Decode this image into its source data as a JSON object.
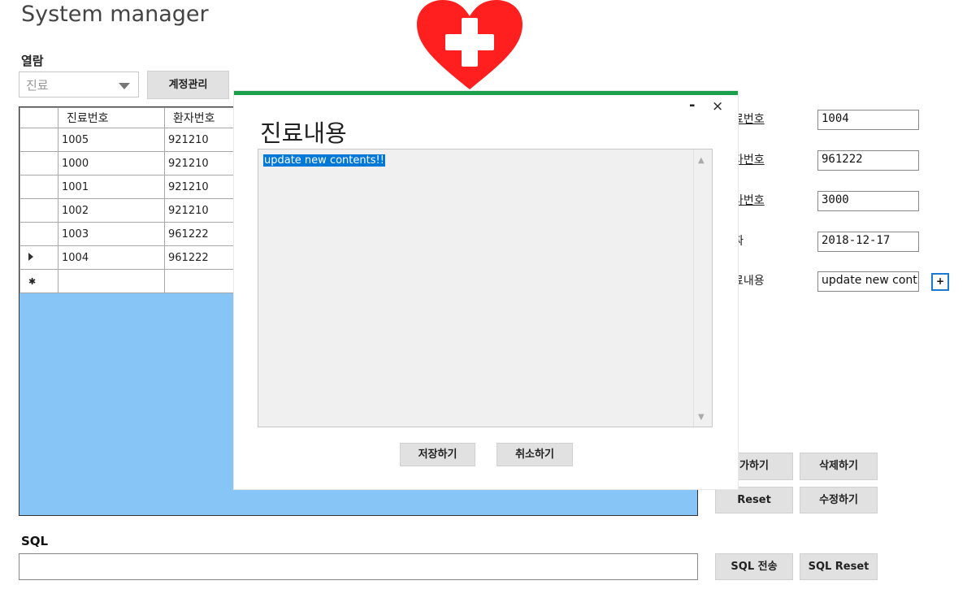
{
  "app": {
    "title": "System manager"
  },
  "view": {
    "label": "열람",
    "combo_value": "진료",
    "account_button": "계정관리"
  },
  "grid": {
    "headers": [
      "진료번호",
      "환자번호"
    ],
    "rows": [
      [
        "1005",
        "921210"
      ],
      [
        "1000",
        "921210"
      ],
      [
        "1001",
        "921210"
      ],
      [
        "1002",
        "921210"
      ],
      [
        "1003",
        "961222"
      ],
      [
        "1004",
        "961222"
      ]
    ],
    "current_row_index": 5
  },
  "form": {
    "labels": [
      "료번호",
      "자번호",
      "사번호",
      "짜",
      "료내용"
    ],
    "values": [
      "1004",
      "961222",
      "3000",
      "2018-12-17",
      "update new cont"
    ]
  },
  "buttons": {
    "add": "가하기",
    "delete": "삭제하기",
    "reset": "Reset",
    "update": "수정하기",
    "sql_send": "SQL 전송",
    "sql_reset": "SQL Reset",
    "plus": "+"
  },
  "sql": {
    "label": "SQL",
    "value": ""
  },
  "dialog": {
    "title": "진료내용",
    "minimize": "-",
    "close": "×",
    "content": "update new contents!!",
    "save_button": "저장하기",
    "cancel_button": "취소하기"
  },
  "colors": {
    "grid_background": "#87c5f7",
    "dialog_accent": "#1aa04d",
    "selection": "#0078d7",
    "heart": "#ff1f1f"
  },
  "icons": {
    "logo": "heart-cross-icon",
    "combo": "chevron-down-icon",
    "row_marker": "current-row-arrow-icon",
    "new_row": "new-row-star-icon"
  }
}
